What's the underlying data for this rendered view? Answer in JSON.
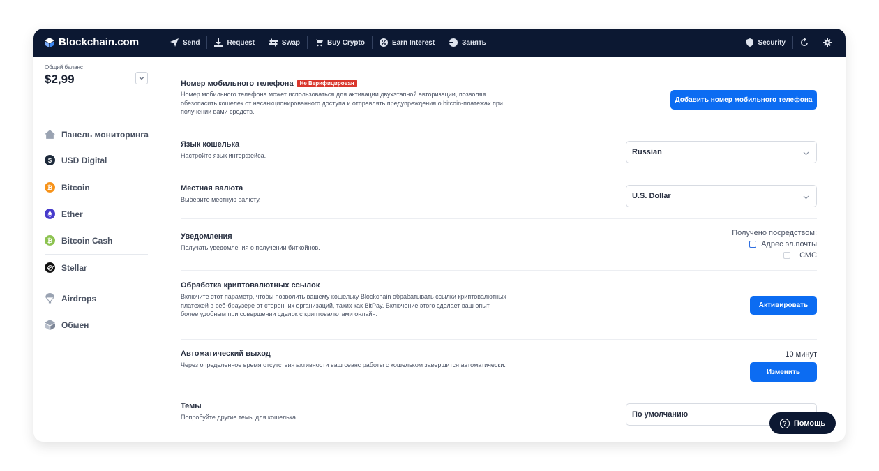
{
  "app": {
    "brand": "Blockchain.com"
  },
  "nav": [
    {
      "label": "Send",
      "icon": "send-icon"
    },
    {
      "label": "Request",
      "icon": "download-icon"
    },
    {
      "label": "Swap",
      "icon": "swap-icon"
    },
    {
      "label": "Buy Crypto",
      "icon": "cart-icon"
    },
    {
      "label": "Earn Interest",
      "icon": "percent-icon"
    },
    {
      "label": "Занять",
      "icon": "pie-icon"
    }
  ],
  "tools": {
    "security_label": "Security"
  },
  "sidebar": {
    "balance_label": "Общий баланс",
    "balance_value": "$2,99",
    "items": [
      {
        "label": "Панель мониторинга",
        "icon": "home-icon"
      },
      {
        "label": "USD Digital",
        "icon": "usd-digital-icon",
        "color": "#1d2a3b",
        "glyph": "$"
      },
      {
        "label": "Bitcoin",
        "icon": "bitcoin-icon",
        "color": "#f7931a",
        "glyph": "₿"
      },
      {
        "label": "Ether",
        "icon": "ether-icon",
        "color": "#473bcb",
        "glyph": "◆"
      },
      {
        "label": "Bitcoin Cash",
        "icon": "bitcoin-cash-icon",
        "color": "#8dc351",
        "glyph": "₿"
      },
      {
        "label": "Stellar",
        "icon": "stellar-icon",
        "color": "#111111",
        "glyph": "✦"
      },
      {
        "label": "Airdrops",
        "icon": "airdrops-icon"
      },
      {
        "label": "Обмен",
        "icon": "exchange-icon"
      }
    ]
  },
  "settings": {
    "phone": {
      "title": "Номер мобильного телефона",
      "badge": "Не Верифицирован",
      "desc": "Номер мобильного телефона может использоваться для активации двухэтапной авторизации, позволяя обезопасить кошелек от несанкционированного доступа и отправлять предупреждения о bitcoin-платежах при получении вами средств.",
      "button": "Добавить номер мобильного телефона"
    },
    "language": {
      "title": "Язык кошелька",
      "desc": "Настройте язык интерфейса.",
      "value": "Russian"
    },
    "currency": {
      "title": "Местная валюта",
      "desc": "Выберите местную валюту.",
      "value": "U.S. Dollar"
    },
    "notifications": {
      "title": "Уведомления",
      "desc": "Получать уведомления о получении биткойнов.",
      "received_via": "Получено посредством:",
      "email_label": "Адрес эл.почты",
      "sms_label": "СМС"
    },
    "links": {
      "title": "Обработка криптовалютных ссылок",
      "desc": "Включите этот параметр, чтобы позволить вашему кошельку Blockchain обрабатывать ссылки криптовалютных платежей в веб-браузере от сторонних организаций, таких как BitPay. Включение этого сделает ваш опыт более удобным при совершении сделок с криптовалютами онлайн.",
      "button": "Активировать"
    },
    "autologout": {
      "title": "Автоматический выход",
      "desc": "Через определенное время отсутствия активности ваш сеанс работы с кошельком завершится автоматически.",
      "value": "10 минут",
      "button": "Изменить"
    },
    "theme": {
      "title": "Темы",
      "desc": "Попробуйте другие темы для кошелька.",
      "value": "По умолчанию"
    }
  },
  "help": {
    "label": "Помощь"
  }
}
